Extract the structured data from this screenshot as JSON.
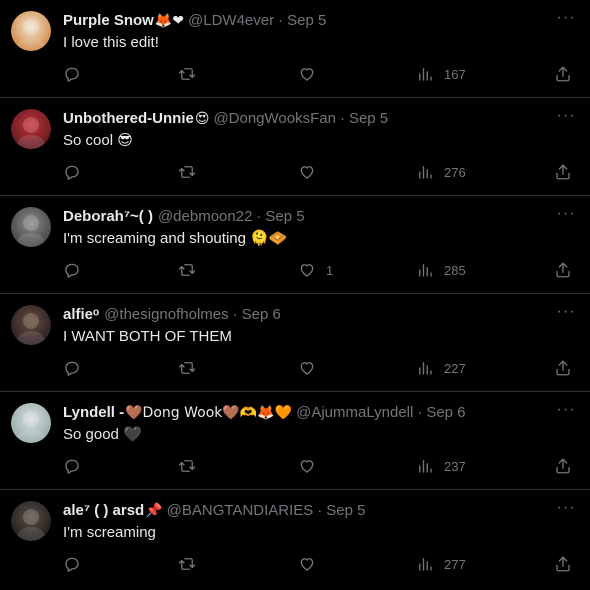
{
  "colors": {
    "background": "#000000",
    "primary_text": "#e7e9ea",
    "secondary_text": "#71767b",
    "divider": "#2f3336"
  },
  "icons": {
    "reply": "reply-icon",
    "retweet": "retweet-icon",
    "like": "heart-icon",
    "views": "views-chart-icon",
    "share": "share-icon",
    "more": "more-icon"
  },
  "replies": [
    {
      "name": "Purple Snow",
      "name_emoji": "🦊❤",
      "handle": "@LDW4ever",
      "time": "Sep 5",
      "text": "I love this edit!",
      "likes": "",
      "views": "167",
      "avatar_colors": [
        "#f2e6d0",
        "#c9782e"
      ]
    },
    {
      "name": "Unbothered-Unnie",
      "name_emoji": "😍",
      "handle": "@DongWooksFan",
      "time": "Sep 5",
      "text": "So cool 😎",
      "likes": "",
      "views": "276",
      "avatar_colors": [
        "#c8303a",
        "#4a1a1e"
      ]
    },
    {
      "name": "Deborah⁷~(  )",
      "name_emoji": "",
      "handle": "@debmoon22",
      "time": "Sep 5",
      "text": "I'm screaming and shouting 🫠🧇",
      "likes": "1",
      "views": "285",
      "avatar_colors": [
        "#8a8a8a",
        "#3a3a3a"
      ]
    },
    {
      "name": "alfieᵒ",
      "name_emoji": "",
      "handle": "@thesignofholmes",
      "time": "Sep 6",
      "text": "I WANT BOTH OF THEM",
      "likes": "",
      "views": "227",
      "avatar_colors": [
        "#6a4a3c",
        "#1e1a22"
      ]
    },
    {
      "name": "Lyndell - ",
      "name_emoji": "🤎Dong Wook🤎🫶🦊🧡",
      "handle": "@AjummaLyndell",
      "time": "Sep 6",
      "text": "So good 🖤",
      "likes": "",
      "views": "237",
      "avatar_colors": [
        "#d8dee0",
        "#8aa0a0"
      ]
    },
    {
      "name": "ale⁷ (  ) arsd",
      "name_emoji": "📌",
      "handle": "@BANGTANDIARIES",
      "time": "Sep 5",
      "text": "I'm screaming",
      "likes": "",
      "views": "277",
      "avatar_colors": [
        "#5a5048",
        "#1a1614"
      ]
    }
  ]
}
